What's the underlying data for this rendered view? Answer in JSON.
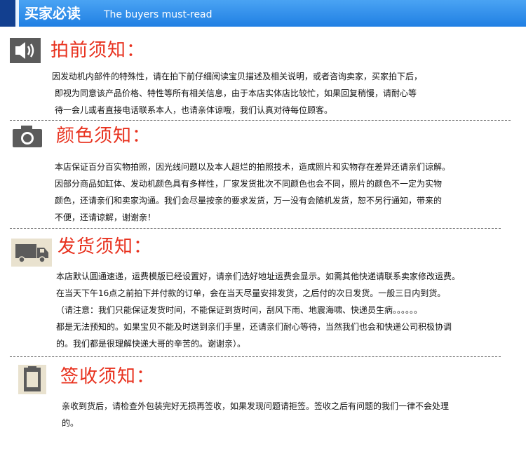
{
  "header": {
    "title_cn": "买家必读",
    "title_en": "The buyers must-read"
  },
  "sections": [
    {
      "title": "拍前须知：",
      "icon": "speaker-icon",
      "lines": [
        "因发动机内部件的特殊性，请在拍下前仔细阅读宝贝描述及相关说明，或者咨询卖家，买家拍下后，",
        "即视为同意该产品价格、特性等所有相关信息，由于本店实体店比较忙，如果回复稍慢，请耐心等",
        "待一会儿或者直接电话联系本人，也请亲体谅哦，我们认真对待每位顾客。"
      ]
    },
    {
      "title": "颜色须知：",
      "icon": "camera-icon",
      "lines": [
        "本店保证百分百实物拍照，因光线问题以及本人超烂的拍照技术，造成照片和实物存在差异还请亲们谅解。",
        "因部分商品如缸体、发动机颜色具有多样性，厂家发货批次不同颜色也会不同，照片的颜色不一定为实物",
        "颜色，还请亲们和卖家沟通。我们会尽量按亲的要求发货，万一没有会随机发货，恕不另行通知，带来的",
        "不便，还请谅解，谢谢亲！"
      ]
    },
    {
      "title": "发货须知：",
      "icon": "truck-icon",
      "lines": [
        "本店默认圆通速递，运费模版已经设置好，请亲们选好地址运费会显示。如需其他快递请联系卖家修改运费。",
        "在当天下午16点之前拍下并付款的订单，会在当天尽量安排发货，之后付的次日发货。一般三日内到货。",
        "（请注意：我们只能保证发货时间，不能保证到货时间，刮风下雨、地震海啸、快递员生病。。。。。。",
        "都是无法预知的。如果宝贝不能及时送到亲们手里，还请亲们耐心等待，当然我们也会和快递公司积极协调",
        "的。我们都是很理解快递大哥的辛苦的。谢谢亲）。"
      ]
    },
    {
      "title": "签收须知：",
      "icon": "document-icon",
      "lines": [
        "亲收到货后，请检查外包装完好无损再签收，如果发现问题请拒签。签收之后有问题的我们一律不会处理",
        "的。"
      ]
    }
  ],
  "colors": {
    "header_blue": "#1f7fe3",
    "header_dark": "#123f8f",
    "title_red": "#e8321f",
    "icon_gray": "#5b5b5b",
    "icon_beige": "#e9e2cf"
  }
}
